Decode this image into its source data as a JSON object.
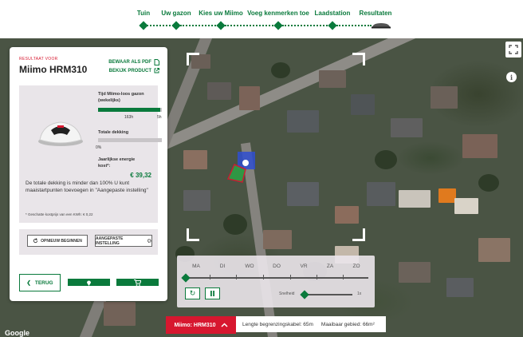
{
  "stepper": {
    "steps": [
      {
        "label": "Tuin"
      },
      {
        "label": "Uw gazon"
      },
      {
        "label": "Kies uw Miimo"
      },
      {
        "label": "Voeg kenmerken toe"
      },
      {
        "label": "Laadstation"
      },
      {
        "label": "Resultaten"
      }
    ],
    "active_index": 5
  },
  "panel": {
    "result_for": "RESULTAAT VOOR",
    "product_name": "Miimo HRM310",
    "save_pdf": "BEWAAR ALS PDF",
    "view_product": "BEKIJK PRODUCT",
    "time_label": "Tijd Miimo-loos gazon (wekelijks)",
    "time_value_left": "163h",
    "time_value_right": "5h",
    "time_fill_fraction": 0.97,
    "coverage_label": "Totale dekking",
    "coverage_value": "0%",
    "coverage_fill_fraction": 0.0,
    "energy_label": "Jaarlijkse energie kost*:",
    "energy_value": "€ 39,32",
    "message": "De totale dekking is minder dan 100% U kunt maaistartpunten toevoegen in \"Aangepaste instelling\"",
    "footnote": "* Geschatte kostprijs van een KWh: € 0,22",
    "restart_label": "OPNIEUW BEGINNEN",
    "custom_label": "AANGEPASTE INSTELLING",
    "back_label": "TERUG"
  },
  "schedule": {
    "days": [
      "MA",
      "DI",
      "WO",
      "DO",
      "VR",
      "ZA",
      "ZO"
    ],
    "speed_label": "Snelheid",
    "speed_value": "1x"
  },
  "bottom": {
    "mimo_tag": "Miimo: HRM310",
    "cable_length": "Lengte begrenzingskabel: 65m",
    "mowable_area": "Maaibaar gebied: 66m²",
    "map_attribution": "Google"
  },
  "colors": {
    "brand_green": "#0a7a3c",
    "accent_red": "#d7172f"
  }
}
